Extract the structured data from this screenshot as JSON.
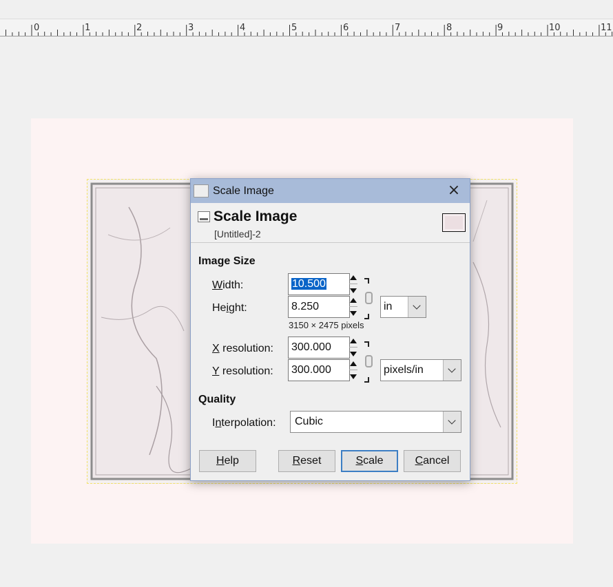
{
  "ruler": {
    "labels": [
      "0",
      "1",
      "2",
      "3",
      "4",
      "5",
      "6",
      "7",
      "8",
      "9",
      "10",
      "11"
    ]
  },
  "dialog": {
    "window_title": "Scale Image",
    "close_glyph": "×",
    "header_title": "Scale Image",
    "header_subtitle": "[Untitled]-2",
    "image_size_label": "Image Size",
    "width_label_u": "W",
    "width_label_rest": "idth:",
    "width_value": "10.500",
    "height_label_pre": "He",
    "height_label_u": "i",
    "height_label_rest": "ght:",
    "height_value": "8.250",
    "size_unit": "in",
    "pixel_dims": "3150 × 2475 pixels",
    "xres_label_u": "X",
    "xres_label_rest": " resolution:",
    "xres_value": "300.000",
    "yres_label_u": "Y",
    "yres_label_rest": " resolution:",
    "yres_value": "300.000",
    "res_unit": "pixels/in",
    "quality_label": "Quality",
    "interp_label_pre": "I",
    "interp_label_u": "n",
    "interp_label_rest": "terpolation:",
    "interp_value": "Cubic",
    "buttons": {
      "help_u": "H",
      "help_rest": "elp",
      "reset_u": "R",
      "reset_rest": "eset",
      "scale_u": "S",
      "scale_rest": "cale",
      "cancel_u": "C",
      "cancel_rest": "ancel"
    }
  }
}
